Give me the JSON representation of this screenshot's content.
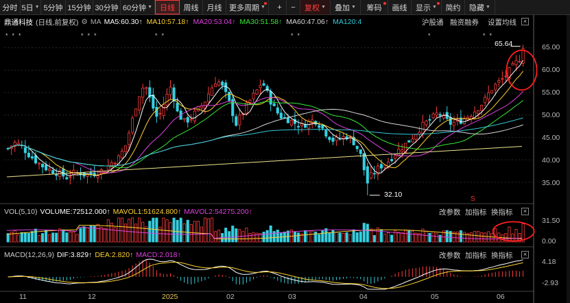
{
  "toolbar": {
    "items": [
      {
        "label": "分时"
      },
      {
        "label": "5日",
        "caret": true
      },
      {
        "label": "5分钟"
      },
      {
        "label": "15分钟"
      },
      {
        "label": "30分钟"
      },
      {
        "label": "60分钟",
        "caret": true
      },
      {
        "label": "日线",
        "active": true
      },
      {
        "label": "周线"
      },
      {
        "label": "月线"
      },
      {
        "label": "更多周期",
        "caret": true,
        "dot": true
      }
    ],
    "right_items": [
      {
        "label": "+"
      },
      {
        "label": "−"
      },
      {
        "label": "复权",
        "caret": true,
        "red": true
      },
      {
        "label": "叠加",
        "caret": true
      },
      {
        "label": "筹码",
        "dot": true
      },
      {
        "label": "画线"
      },
      {
        "label": "显示",
        "caret": true,
        "dot": true
      },
      {
        "label": "简约"
      },
      {
        "label": "隐藏",
        "caret": true
      }
    ]
  },
  "main_panel": {
    "stock_name": "鼎通科技",
    "mode": "(日线,前复权)",
    "gear": "⚙",
    "ma_label": "MA",
    "ma": [
      {
        "label": "MA5:60.30↑",
        "color": "#ffffff"
      },
      {
        "label": "MA10:57.18↑",
        "color": "#ffd22e"
      },
      {
        "label": "MA20:53.04↑",
        "color": "#e040e0"
      },
      {
        "label": "MA30:51.58↑",
        "color": "#38e838"
      },
      {
        "label": "MA60:47.06↑",
        "color": "#d8d8d8"
      },
      {
        "label": "MA120:4",
        "color": "#36c8d8"
      }
    ],
    "buttons": [
      "沪股通",
      "融资融券",
      "设置均线"
    ],
    "high_label": "65.64",
    "low_label": "32.10",
    "y_ticks": [
      "65.00",
      "60.00",
      "55.00",
      "50.00",
      "45.00",
      "40.00",
      "35.00"
    ]
  },
  "vol_panel": {
    "title": "VOL(5,10)",
    "volume": "VOLUME:72512.000↑",
    "mavol1": "MAVOL1:51624.800↑",
    "mavol2": "MAVOL2:54275.200↑",
    "buttons": [
      "改参数",
      "加指标",
      "换指标"
    ],
    "y_ticks": [
      "31.50",
      "0.00"
    ]
  },
  "macd_panel": {
    "title": "MACD(12,26,9)",
    "dif": "DIF:3.829↑",
    "dea": "DEA:2.820↑",
    "macd": "MACD:2.018↑",
    "buttons": [
      "改参数",
      "加指标",
      "换指标"
    ],
    "y_ticks": [
      "4.18",
      "-2.93"
    ]
  },
  "dates": [
    "11",
    "12",
    "2025",
    "02",
    "03",
    "04",
    "05",
    "06"
  ],
  "colors": {
    "up": "#ff3b3b",
    "down": "#34d0e0",
    "accent": "#ff3b3b",
    "bg": "#000000"
  },
  "chart_data": {
    "type": "candlestick",
    "price_range": [
      31,
      68
    ],
    "month_sequence": [
      "11",
      "12",
      "2025-01",
      "02",
      "03",
      "04",
      "05",
      "06"
    ],
    "close_path": [
      42.5,
      43.8,
      43.2,
      41.5,
      40.1,
      38.9,
      38.0,
      37.5,
      36.8,
      36.1,
      37.0,
      37.2,
      36.5,
      36.9,
      37.3,
      38.1,
      39.5,
      40.5,
      43.0,
      48.5,
      54.2,
      57.0,
      52.5,
      49.0,
      53.0,
      56.5,
      50.5,
      48.5,
      49.2,
      51.0,
      52.5,
      55.5,
      58.0,
      56.0,
      52.5,
      48.0,
      50.5,
      53.0,
      55.0,
      57.5,
      54.0,
      51.0,
      49.5,
      49.0,
      48.2,
      47.5,
      48.3,
      49.0,
      47.5,
      45.5,
      44.2,
      44.8,
      45.3,
      44.0,
      41.5,
      35.5,
      36.8,
      38.5,
      39.2,
      40.8,
      42.3,
      43.5,
      45.0,
      46.8,
      48.2,
      49.2,
      50.5,
      49.0,
      48.0,
      48.5,
      49.2,
      50.2,
      51.5,
      53.0,
      55.5,
      57.0,
      58.2,
      60.0,
      61.8,
      63.5
    ],
    "volume_range": [
      0,
      31.5
    ],
    "macd_range": [
      -2.93,
      4.18
    ],
    "last": {
      "ma5": 60.3,
      "ma10": 57.18,
      "ma20": 53.04,
      "ma30": 51.58,
      "ma60": 47.06,
      "volume": 72512,
      "mavol1": 51624.8,
      "mavol2": 54275.2,
      "dif": 3.829,
      "dea": 2.82,
      "macd": 2.018
    },
    "high": 65.64,
    "low": 32.1
  }
}
